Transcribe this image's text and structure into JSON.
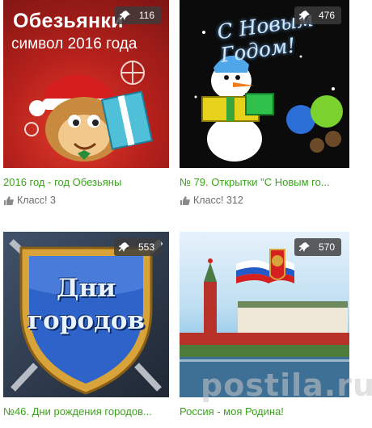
{
  "cards": [
    {
      "image": {
        "title_line1": "Обезьянки",
        "title_line2": "символ 2016 года"
      },
      "pin_count": "116",
      "caption": "2016 год - год Обезьяны",
      "likes": "Класс! 3"
    },
    {
      "image": {
        "title": "С Новым Годом!"
      },
      "pin_count": "476",
      "caption": "№ 79. Открытки \"С Новым го...",
      "likes": "Класс! 312"
    },
    {
      "image": {
        "title": "Дни городов"
      },
      "pin_count": "553",
      "caption": "№46. Дни рождения городов...",
      "likes": ""
    },
    {
      "image": {
        "title": ""
      },
      "pin_count": "570",
      "caption": "Россия - моя Родина!",
      "likes": ""
    }
  ],
  "watermark": "postila.ru",
  "colors": {
    "caption": "#3aa51b",
    "likes_text": "#6b6b6b",
    "badge_bg": "#3c3c3c"
  }
}
